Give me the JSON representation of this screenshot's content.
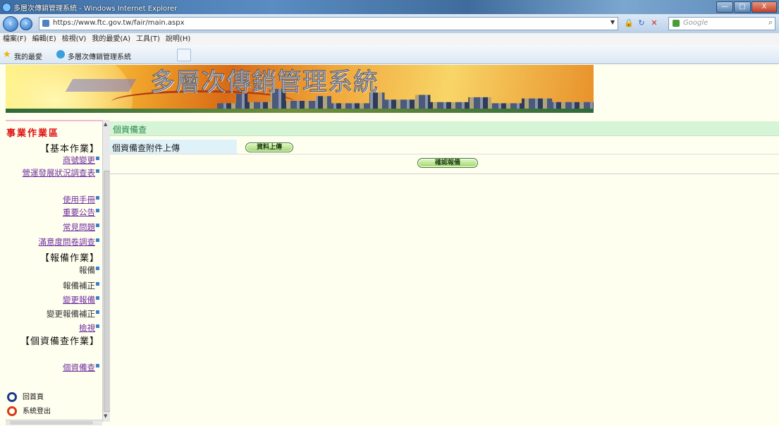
{
  "window": {
    "title": "多層次傳銷管理系統 - Windows Internet Explorer",
    "controls": [
      "—",
      "□",
      "X"
    ]
  },
  "address": {
    "url": "https://www.ftc.gov.tw/fair/main.aspx",
    "search_placeholder": "Google"
  },
  "menu": [
    "檔案(F)",
    "編輯(E)",
    "檢視(V)",
    "我的最愛(A)",
    "工具(T)",
    "說明(H)"
  ],
  "favorites": {
    "label": "我的最愛",
    "tab_title": "多層次傳銷管理系統"
  },
  "banner": {
    "title": "多層次傳銷管理系統"
  },
  "sidebar": {
    "area_title": "事業作業區",
    "basic_section": "【基本作業】",
    "basic_items": [
      "商號變更",
      "營運發展狀況調查表",
      "使用手冊",
      "重要公告",
      "常見問題",
      "滿意度問卷調查"
    ],
    "report_section": "【報備作業】",
    "report_items": [
      "報備",
      "報備補正",
      "變更報備",
      "變更報備補正",
      "檢視"
    ],
    "privacy_section": "【個資備查作業】",
    "privacy_items": [
      "個資備查"
    ],
    "home": "回首頁",
    "logout": "系統登出"
  },
  "main": {
    "header": "個資備查",
    "row_label": "個資備查附件上傳",
    "upload_button": "資料上傳",
    "confirm_button": "確認報備"
  },
  "colors": {
    "header_bg": "#d6f5d6",
    "label_bg": "#dff2fa",
    "page_bg": "#fffff0",
    "area_title": "#dd1111"
  }
}
